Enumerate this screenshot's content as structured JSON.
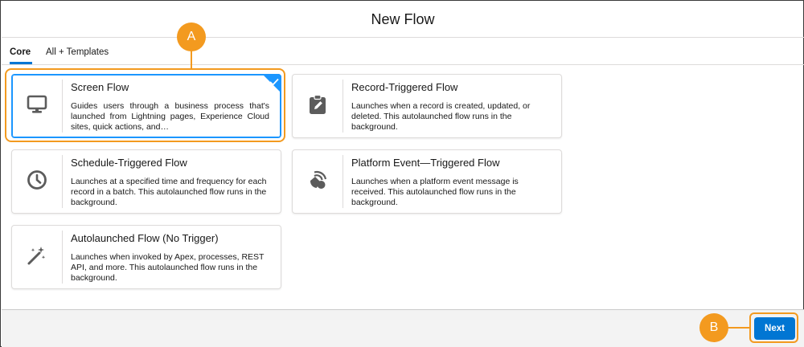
{
  "modal": {
    "title": "New Flow"
  },
  "tabs": [
    {
      "label": "Core",
      "active": true
    },
    {
      "label": "All + Templates",
      "active": false
    }
  ],
  "flow_types": [
    {
      "title": "Screen Flow",
      "description": "Guides users through a business process that's launched from Lightning pages, Experience Cloud sites, quick actions, and…",
      "icon": "desktop-icon",
      "selected": true
    },
    {
      "title": "Record-Triggered Flow",
      "description": "Launches when a record is created, updated, or deleted. This autolaunched flow runs in the background.",
      "icon": "clipboard-edit-icon",
      "selected": false
    },
    {
      "title": "Schedule-Triggered Flow",
      "description": "Launches at a specified time and frequency for each record in a batch. This autolaunched flow runs in the background.",
      "icon": "clock-icon",
      "selected": false
    },
    {
      "title": "Platform Event—Triggered Flow",
      "description": "Launches when a platform event message is received. This autolaunched flow runs in the background.",
      "icon": "platform-event-icon",
      "selected": false
    },
    {
      "title": "Autolaunched Flow (No Trigger)",
      "description": "Launches when invoked by Apex, processes, REST API, and more. This autolaunched flow runs in the background.",
      "icon": "magic-wand-icon",
      "selected": false
    }
  ],
  "footer": {
    "next_label": "Next"
  },
  "callouts": {
    "a": "A",
    "b": "B"
  },
  "colors": {
    "brand_blue": "#0176d3",
    "selected_border": "#1b96ff",
    "callout_orange": "#f39a1f",
    "icon_gray": "#5c5c5c"
  }
}
